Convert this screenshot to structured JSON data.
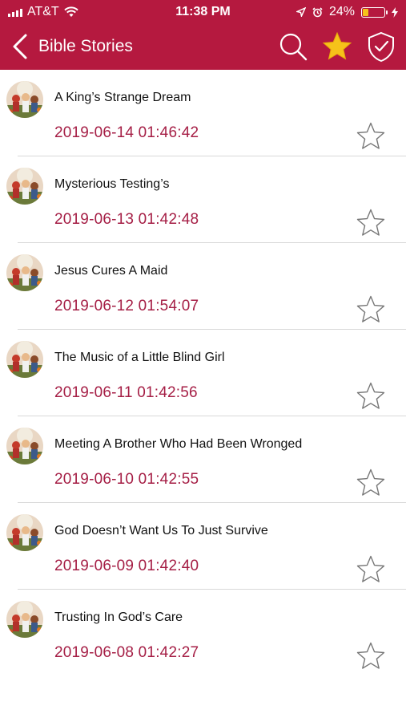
{
  "status": {
    "carrier": "AT&T",
    "time": "11:38 PM",
    "battery": "24%",
    "battery_level": 0.24
  },
  "nav": {
    "title": "Bible Stories"
  },
  "stories": [
    {
      "title": "A King’s Strange Dream",
      "date": "2019-06-14 01:46:42"
    },
    {
      "title": "Mysterious Testing’s",
      "date": "2019-06-13 01:42:48"
    },
    {
      "title": "Jesus Cures A Maid",
      "date": "2019-06-12 01:54:07"
    },
    {
      "title": "The Music of a Little Blind Girl",
      "date": "2019-06-11 01:42:56"
    },
    {
      "title": "Meeting A Brother Who Had Been Wronged",
      "date": "2019-06-10 01:42:55"
    },
    {
      "title": "God Doesn’t Want Us To Just Survive",
      "date": "2019-06-09 01:42:40"
    },
    {
      "title": "Trusting In God’s Care",
      "date": "2019-06-08 01:42:27"
    }
  ],
  "colors": {
    "brand": "#b5193f",
    "date": "#a51e45",
    "star_active": "#f6c21a"
  },
  "icons": [
    "back-icon",
    "search-icon",
    "favorites-star-icon",
    "shield-check-icon",
    "star-outline-icon"
  ]
}
